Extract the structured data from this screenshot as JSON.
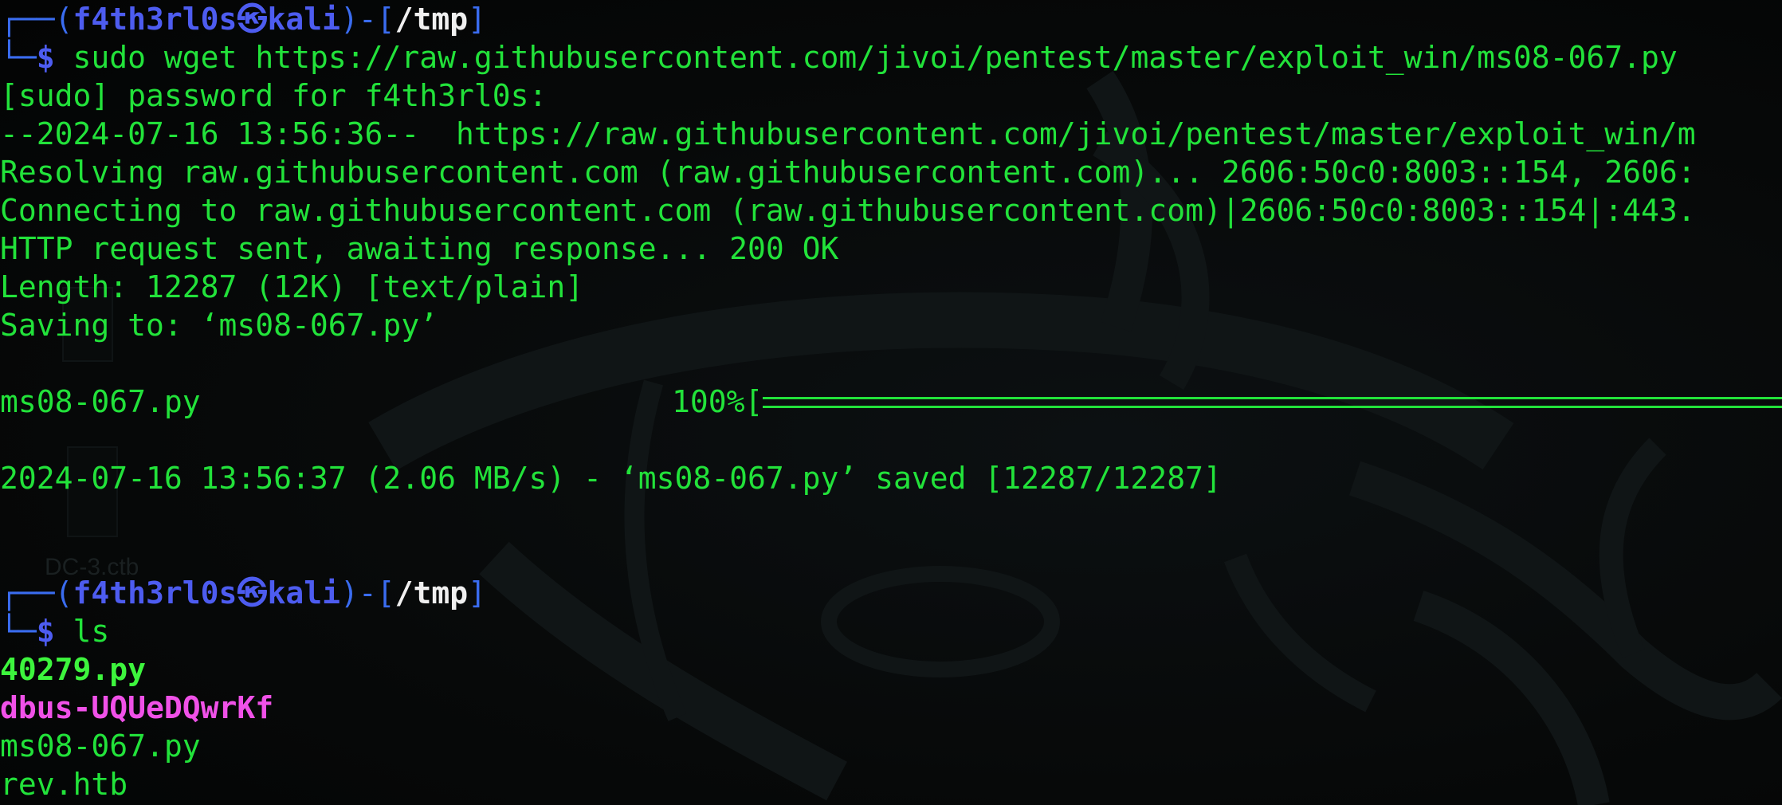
{
  "prompt1": {
    "box_open": "┌──(",
    "user": "f4th3rl0s",
    "skull": "㉿",
    "host": "kali",
    "box_mid": ")-[",
    "path": "/tmp",
    "box_close": "]",
    "box_corner": "└─",
    "dollar": "$",
    "command": " sudo wget https://raw.githubusercontent.com/jivoi/pentest/master/exploit_win/ms08-067.py"
  },
  "wget_output": [
    "[sudo] password for f4th3rl0s:",
    "--2024-07-16 13:56:36--  https://raw.githubusercontent.com/jivoi/pentest/master/exploit_win/m",
    "Resolving raw.githubusercontent.com (raw.githubusercontent.com)... 2606:50c0:8003::154, 2606:",
    "Connecting to raw.githubusercontent.com (raw.githubusercontent.com)|2606:50c0:8003::154|:443.",
    "HTTP request sent, awaiting response... 200 OK",
    "Length: 12287 (12K) [text/plain]",
    "Saving to: ‘ms08-067.py’"
  ],
  "progress": {
    "filename": "ms08-067.py",
    "percent_label": "100%[",
    "fraction": 1.0
  },
  "saved_line": "2024-07-16 13:56:37 (2.06 MB/s) - ‘ms08-067.py’ saved [12287/12287]",
  "prompt2": {
    "box_open": "┌──(",
    "user": "f4th3rl0s",
    "skull": "㉿",
    "host": "kali",
    "box_mid": ")-[",
    "path": "/tmp",
    "box_close": "]",
    "box_corner": "└─",
    "dollar": "$",
    "command": " ls"
  },
  "ls_output": {
    "executable": "40279.py",
    "directory": "dbus-UQUeDQwrKf",
    "file1": "ms08-067.py",
    "file2": "rev.htb"
  },
  "desktop_ghost": {
    "label": "DC-3.ctb"
  },
  "colors": {
    "background": "#050606",
    "text_green": "#22e23a",
    "prompt_blue": "#4d5cf0",
    "path_white": "#f0f0f0",
    "dir_magenta": "#f051e8"
  }
}
